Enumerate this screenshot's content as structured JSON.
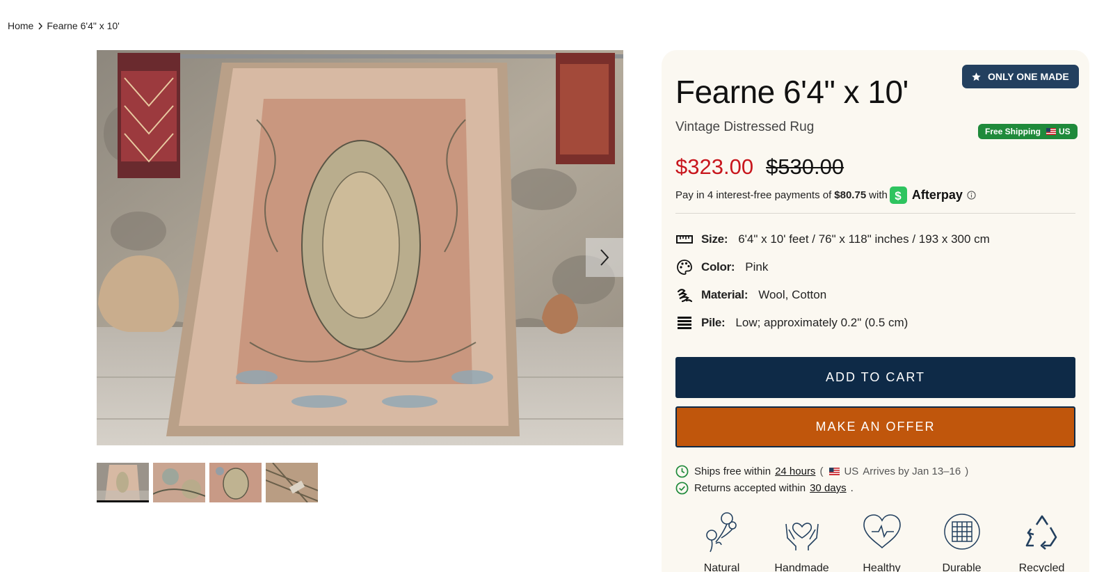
{
  "breadcrumb": {
    "home": "Home",
    "current": "Fearne 6'4\" x 10'"
  },
  "gallery": {
    "thumbnail_count": 4,
    "active_thumbnail": 1
  },
  "product": {
    "title": "Fearne 6'4\" x 10'",
    "subtitle": "Vintage Distressed Rug",
    "badge": "ONLY ONE MADE",
    "shipping_badge": "Free Shipping",
    "shipping_region": "US",
    "price": "$323.00",
    "original_price": "$530.00"
  },
  "afterpay": {
    "prefix": "Pay in 4 interest-free payments of",
    "amount": "$80.75",
    "with": "with",
    "brand": "Afterpay"
  },
  "specs": [
    {
      "label": "Size:",
      "value": "6'4\" x 10' feet / 76\" x 118\" inches / 193 x 300 cm",
      "icon": "ruler-icon"
    },
    {
      "label": "Color:",
      "value": "Pink",
      "icon": "palette-icon"
    },
    {
      "label": "Material:",
      "value": "Wool, Cotton",
      "icon": "yarn-icon"
    },
    {
      "label": "Pile:",
      "value": "Low; approximately 0.2\" (0.5 cm)",
      "icon": "layers-icon"
    }
  ],
  "buttons": {
    "add_to_cart": "ADD TO CART",
    "make_offer": "MAKE AN OFFER"
  },
  "policies": {
    "ships_text": "Ships free within",
    "ships_link": "24 hours",
    "ships_open": "(",
    "ships_country": "US",
    "ships_arrival": "Arrives by Jan 13–16",
    "ships_close": ")",
    "returns_text": "Returns accepted within",
    "returns_link": "30 days",
    "returns_end": "."
  },
  "features": [
    {
      "label": "Natural",
      "icon": "flower-icon"
    },
    {
      "label": "Handmade",
      "icon": "hands-heart-icon"
    },
    {
      "label": "Healthy",
      "icon": "heartbeat-icon"
    },
    {
      "label": "Durable",
      "icon": "grid-circle-icon"
    },
    {
      "label": "Recycled",
      "icon": "recycle-icon"
    }
  ],
  "colors": {
    "price_sale": "#c8161d",
    "badge_navy": "#23405f",
    "cart_button": "#0e2a47",
    "offer_button": "#c0560c",
    "shipping_green": "#1f8a3b",
    "afterpay_green": "#2ec45f",
    "panel_bg": "#fbf8f1"
  }
}
